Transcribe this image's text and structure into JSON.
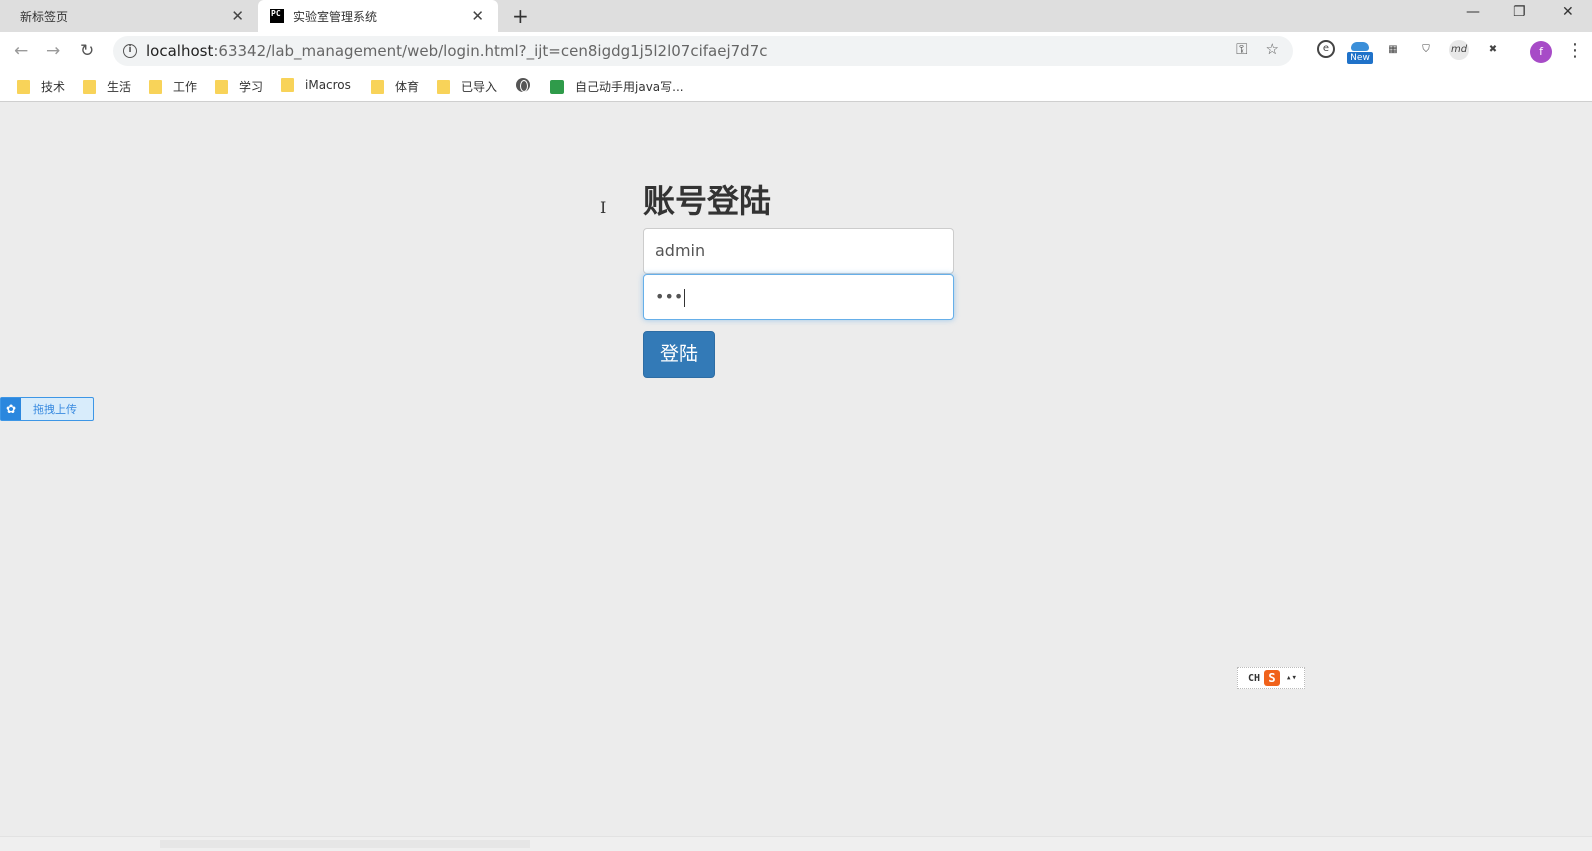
{
  "tabs": [
    {
      "title": "新标签页",
      "close": "✕"
    },
    {
      "title": "实验室管理系统",
      "favicon": "PC",
      "close": "✕"
    }
  ],
  "new_tab_symbol": "+",
  "window_controls": {
    "minimize": "—",
    "restore": "❐",
    "close": "✕"
  },
  "nav": {
    "back": "←",
    "forward": "→",
    "reload": "↻"
  },
  "address": {
    "info_icon": "i",
    "host": "localhost",
    "path": ":63342/lab_management/web/login.html?_ijt=cen8igdg1j5l2l07cifaej7d7c",
    "key_icon": "⚿",
    "star_icon": "☆"
  },
  "extensions": {
    "new_badge": "New",
    "md_label": "md",
    "x_label": "✖",
    "profile_initial": "f",
    "menu": "⋮"
  },
  "bookmarks": [
    "技术",
    "生活",
    "工作",
    "学习",
    "iMacros",
    "体育",
    "已导入",
    "自己动手用java写..."
  ],
  "login": {
    "title": "账号登陆",
    "username_value": "admin",
    "password_mask": "•••",
    "submit_label": "登陆"
  },
  "upload_widget": {
    "label": "拖拽上传",
    "icon": "✿"
  },
  "ime": {
    "mode": "CH",
    "logo": "S",
    "arrows": "▴▾"
  },
  "colors": {
    "page_bg": "#ececec",
    "primary_button": "#337ab7",
    "focus_border": "#66afe9"
  }
}
